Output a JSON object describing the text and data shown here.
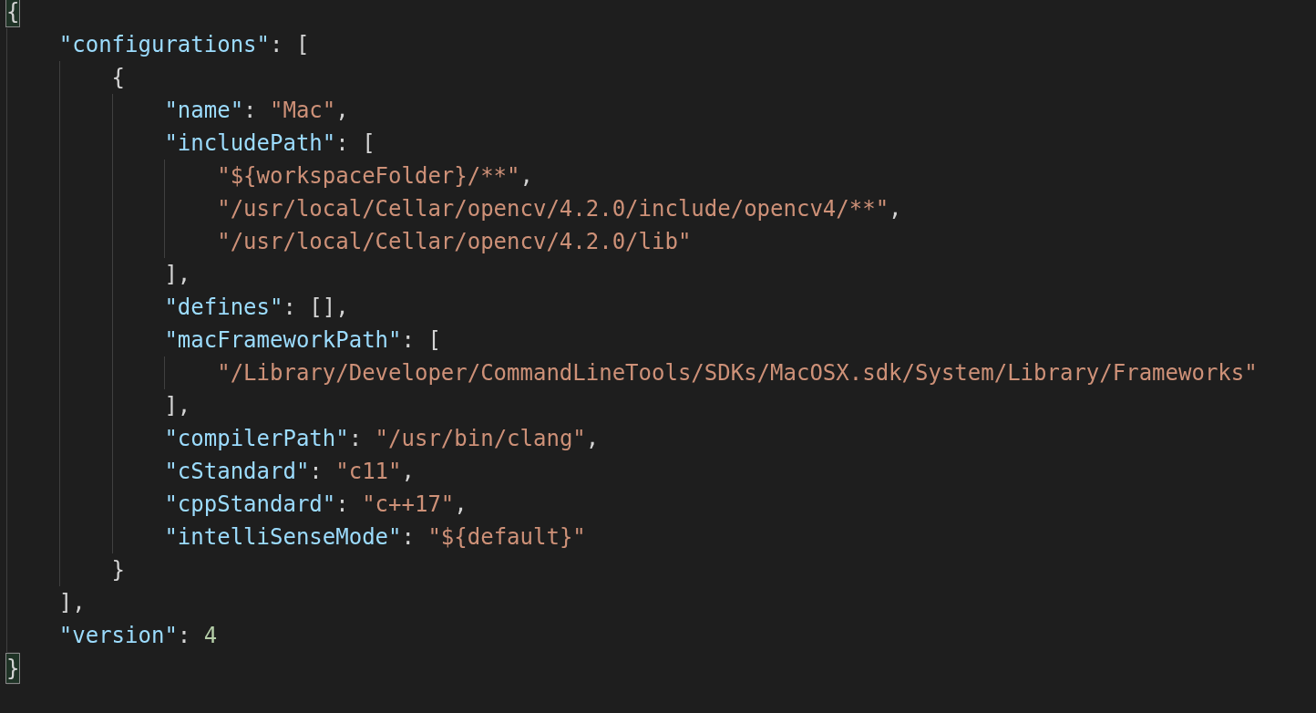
{
  "editor": {
    "lines": [
      {
        "current": false,
        "tokens": [
          {
            "kind": "punct",
            "text": "{",
            "matched": true
          }
        ],
        "children": [
          {
            "current": false,
            "tokens": [
              {
                "kind": "key",
                "text": "\"configurations\""
              },
              {
                "kind": "punct",
                "text": ": ["
              }
            ],
            "children": [
              {
                "current": false,
                "tokens": [
                  {
                    "kind": "punct",
                    "text": "{"
                  }
                ],
                "children": [
                  {
                    "current": false,
                    "tokens": [
                      {
                        "kind": "key",
                        "text": "\"name\""
                      },
                      {
                        "kind": "punct",
                        "text": ": "
                      },
                      {
                        "kind": "string",
                        "text": "\"Mac\""
                      },
                      {
                        "kind": "punct",
                        "text": ","
                      }
                    ]
                  },
                  {
                    "current": false,
                    "tokens": [
                      {
                        "kind": "key",
                        "text": "\"includePath\""
                      },
                      {
                        "kind": "punct",
                        "text": ": ["
                      }
                    ],
                    "children": [
                      {
                        "current": false,
                        "tokens": [
                          {
                            "kind": "string",
                            "text": "\"${workspaceFolder}/**\""
                          },
                          {
                            "kind": "punct",
                            "text": ","
                          }
                        ]
                      },
                      {
                        "current": false,
                        "tokens": [
                          {
                            "kind": "string",
                            "text": "\"/usr/local/Cellar/opencv/4.2.0/include/opencv4/**\""
                          },
                          {
                            "kind": "punct",
                            "text": ","
                          }
                        ]
                      },
                      {
                        "current": false,
                        "tokens": [
                          {
                            "kind": "string",
                            "text": "\"/usr/local/Cellar/opencv/4.2.0/lib\""
                          }
                        ]
                      }
                    ]
                  },
                  {
                    "current": false,
                    "tokens": [
                      {
                        "kind": "punct",
                        "text": "],"
                      }
                    ]
                  },
                  {
                    "current": false,
                    "tokens": [
                      {
                        "kind": "key",
                        "text": "\"defines\""
                      },
                      {
                        "kind": "punct",
                        "text": ": [],"
                      }
                    ]
                  },
                  {
                    "current": false,
                    "tokens": [
                      {
                        "kind": "key",
                        "text": "\"macFrameworkPath\""
                      },
                      {
                        "kind": "punct",
                        "text": ": ["
                      }
                    ],
                    "children": [
                      {
                        "current": false,
                        "tokens": [
                          {
                            "kind": "string",
                            "text": "\"/Library/Developer/CommandLineTools/SDKs/MacOSX.sdk/System/Library/Frameworks\""
                          }
                        ]
                      }
                    ]
                  },
                  {
                    "current": false,
                    "tokens": [
                      {
                        "kind": "punct",
                        "text": "],"
                      }
                    ]
                  },
                  {
                    "current": false,
                    "tokens": [
                      {
                        "kind": "key",
                        "text": "\"compilerPath\""
                      },
                      {
                        "kind": "punct",
                        "text": ": "
                      },
                      {
                        "kind": "string",
                        "text": "\"/usr/bin/clang\""
                      },
                      {
                        "kind": "punct",
                        "text": ","
                      }
                    ]
                  },
                  {
                    "current": false,
                    "tokens": [
                      {
                        "kind": "key",
                        "text": "\"cStandard\""
                      },
                      {
                        "kind": "punct",
                        "text": ": "
                      },
                      {
                        "kind": "string",
                        "text": "\"c11\""
                      },
                      {
                        "kind": "punct",
                        "text": ","
                      }
                    ]
                  },
                  {
                    "current": false,
                    "tokens": [
                      {
                        "kind": "key",
                        "text": "\"cppStandard\""
                      },
                      {
                        "kind": "punct",
                        "text": ": "
                      },
                      {
                        "kind": "string",
                        "text": "\"c++17\""
                      },
                      {
                        "kind": "punct",
                        "text": ","
                      }
                    ]
                  },
                  {
                    "current": false,
                    "tokens": [
                      {
                        "kind": "key",
                        "text": "\"intelliSenseMode\""
                      },
                      {
                        "kind": "punct",
                        "text": ": "
                      },
                      {
                        "kind": "string",
                        "text": "\"${default}\""
                      }
                    ]
                  }
                ]
              },
              {
                "current": false,
                "tokens": [
                  {
                    "kind": "punct",
                    "text": "}"
                  }
                ]
              }
            ]
          },
          {
            "current": false,
            "tokens": [
              {
                "kind": "punct",
                "text": "],"
              }
            ]
          },
          {
            "current": false,
            "tokens": [
              {
                "kind": "key",
                "text": "\"version\""
              },
              {
                "kind": "punct",
                "text": ": "
              },
              {
                "kind": "number",
                "text": "4"
              }
            ]
          }
        ]
      },
      {
        "current": true,
        "tokens": [
          {
            "kind": "punct",
            "text": "}",
            "matched": true
          }
        ]
      }
    ]
  }
}
